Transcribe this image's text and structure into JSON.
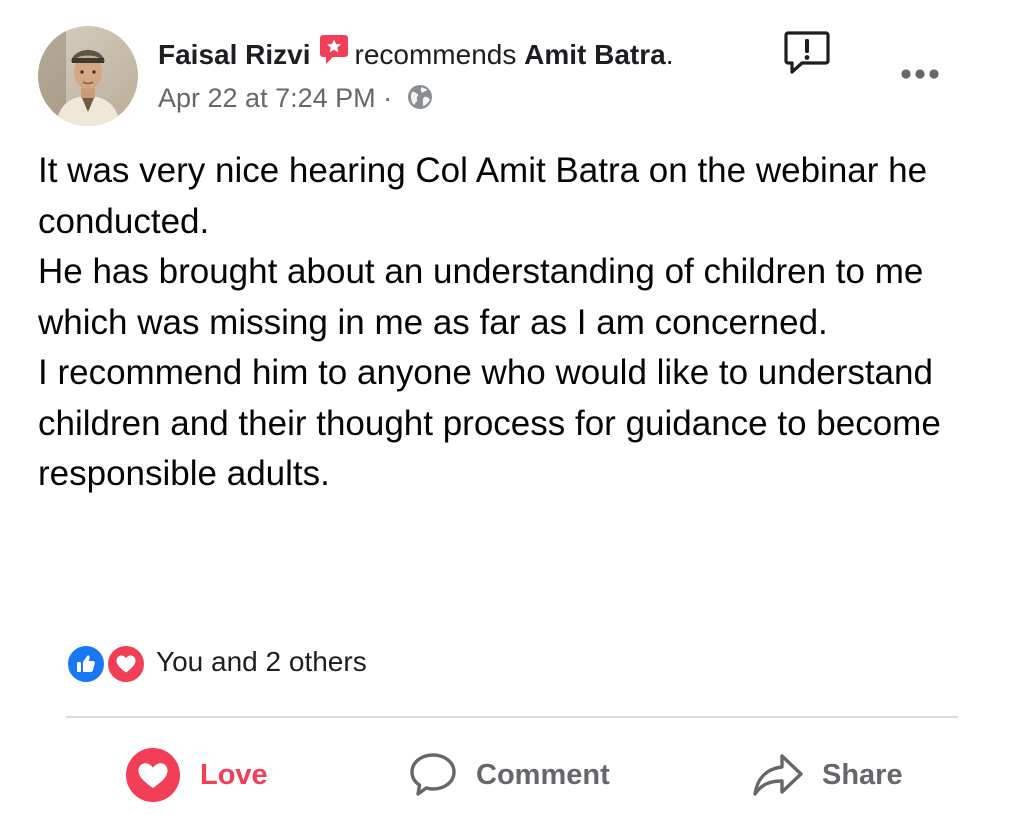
{
  "post": {
    "author": "Faisal Rizvi",
    "recommends_text": "recommends",
    "recommended_page": "Amit Batra",
    "period": ".",
    "timestamp": "Apr 22 at 7:24 PM",
    "separator": "·",
    "privacy_icon": "globe-icon",
    "body": [
      "It was very nice hearing Col Amit Batra on the webinar he conducted.",
      "He has brought about an understanding of children to me which was missing in me as far as I am concerned.",
      "I recommend him to anyone who would like to understand children and their thought process for guidance to become responsible adults."
    ]
  },
  "reactions": {
    "icons": [
      "like-icon",
      "love-icon"
    ],
    "summary": "You and 2 others"
  },
  "actions": {
    "love_label": "Love",
    "comment_label": "Comment",
    "share_label": "Share"
  },
  "colors": {
    "love_red": "#f33e58",
    "like_blue": "#1877f2",
    "secondary_text": "#65676b",
    "divider": "#dadde1"
  }
}
